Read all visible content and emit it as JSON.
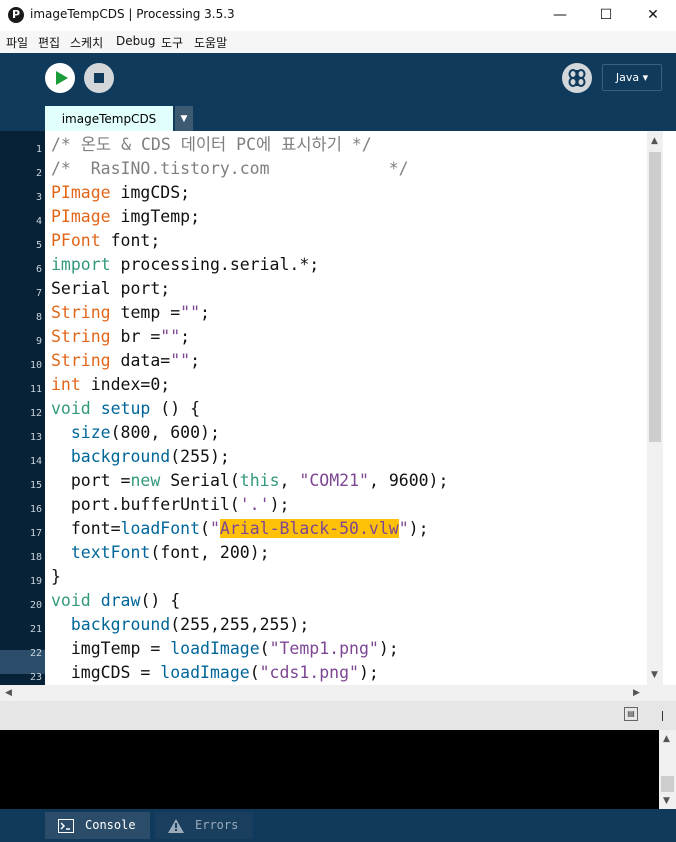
{
  "window": {
    "title": "imageTempCDS | Processing 3.5.3",
    "app_icon": "P",
    "minimize": "—",
    "maximize": "☐",
    "close": "✕"
  },
  "menu": [
    "파일",
    "편집",
    "스케치",
    "Debug",
    "도구",
    "도움말"
  ],
  "toolbar": {
    "mode": "Java ▾"
  },
  "tab": {
    "name": "imageTempCDS",
    "menu_glyph": "▼"
  },
  "editor": {
    "current_line": 17,
    "lines": [
      {
        "n": "1",
        "t": "/* 온도 & CDS 데이터 PC에 표시하기 */"
      },
      {
        "n": "2",
        "t": "/*  RasINO.tistory.com            */"
      },
      {
        "n": "3",
        "t": "PImage imgCDS;"
      },
      {
        "n": "4",
        "t": "PImage imgTemp;"
      },
      {
        "n": "5",
        "t": "PFont font;"
      },
      {
        "n": "6",
        "t": "import processing.serial.*;"
      },
      {
        "n": "7",
        "t": "Serial port;"
      },
      {
        "n": "8",
        "t": "String temp =\"\";"
      },
      {
        "n": "9",
        "t": "String br =\"\";"
      },
      {
        "n": "10",
        "t": "String data=\"\";"
      },
      {
        "n": "11",
        "t": "int index=0;"
      },
      {
        "n": "12",
        "t": "void setup () {"
      },
      {
        "n": "13",
        "t": "  size(800, 600);"
      },
      {
        "n": "14",
        "t": "  background(255);"
      },
      {
        "n": "15",
        "t": "  port =new Serial(this, \"COM21\", 9600);"
      },
      {
        "n": "16",
        "t": "  port.bufferUntil('.');"
      },
      {
        "n": "17",
        "t": "  font=loadFont(\"Arial-Black-50.vlw\");"
      },
      {
        "n": "18",
        "t": "  textFont(font, 200);"
      },
      {
        "n": "19",
        "t": "}"
      },
      {
        "n": "20",
        "t": "void draw() {"
      },
      {
        "n": "21",
        "t": "  background(255,255,255);"
      },
      {
        "n": "22",
        "t": "  imgTemp = loadImage(\"Temp1.png\");"
      },
      {
        "n": "23",
        "t": "  imgCDS = loadImage(\"cds1.png\");"
      }
    ]
  },
  "bottom_tabs": {
    "console": "Console",
    "errors": "Errors"
  },
  "colors": {
    "toolbar_bg": "#0f3a5c",
    "gutter_bg": "#072136",
    "tab_active_bg": "#e0fffd",
    "selection": "#ffc107",
    "type": "#e2661a",
    "keyword": "#33997e",
    "function": "#006699",
    "string": "#7d4793",
    "comment": "#7f7f7f"
  }
}
